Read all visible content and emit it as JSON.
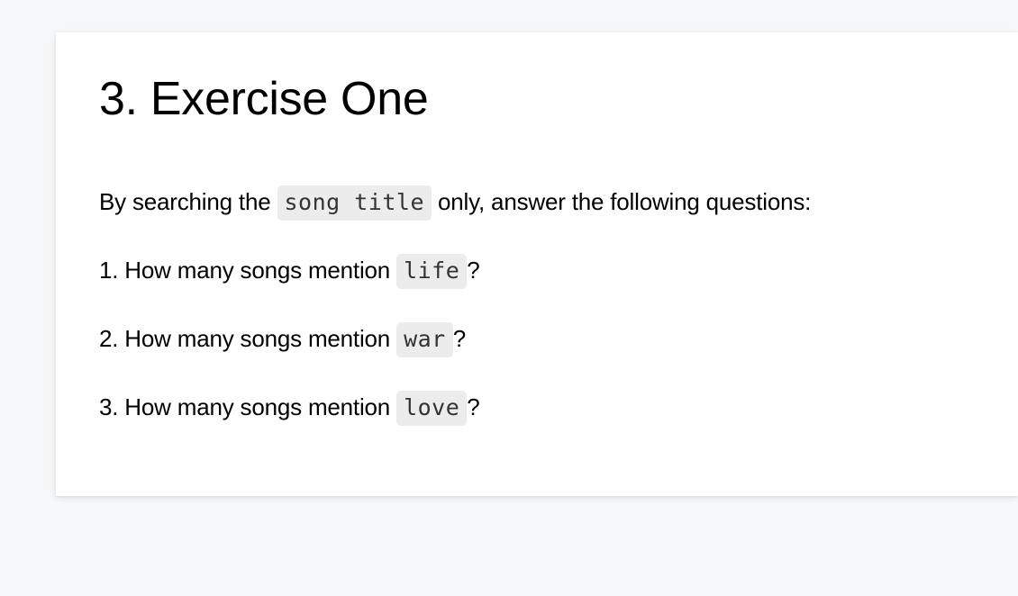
{
  "exercise": {
    "title": "3. Exercise One",
    "intro": {
      "before": "By searching the ",
      "code": "song title",
      "after": " only, answer the following questions:"
    },
    "questions": [
      {
        "prefix": "1. How many songs mention ",
        "term": "life",
        "suffix": "?"
      },
      {
        "prefix": "2. How many songs mention ",
        "term": "war",
        "suffix": "?"
      },
      {
        "prefix": "3. How many songs mention ",
        "term": "love",
        "suffix": "?"
      }
    ]
  }
}
